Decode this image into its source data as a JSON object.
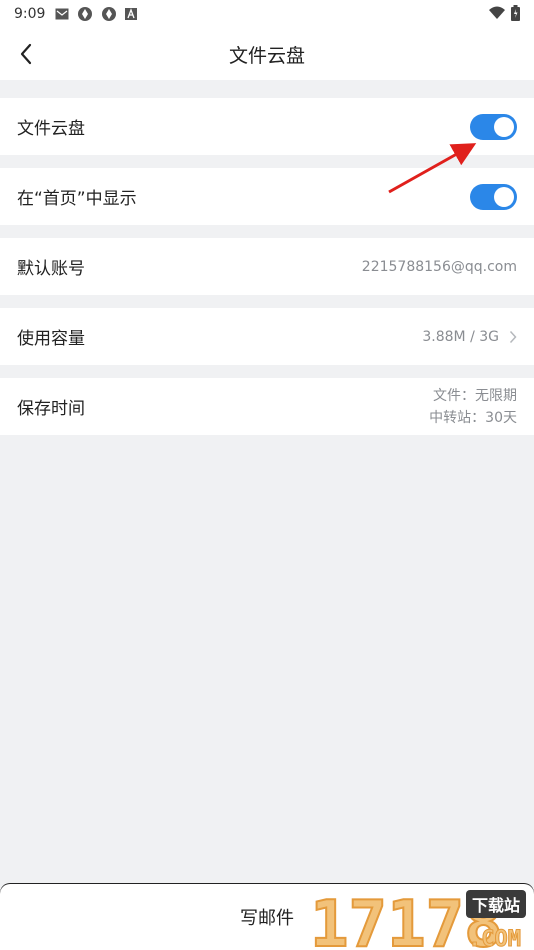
{
  "status_bar": {
    "time": "9:09",
    "icons": [
      "mail-icon",
      "app-icon",
      "app-icon",
      "a-icon"
    ],
    "right_icons": [
      "wifi-icon",
      "battery-icon"
    ]
  },
  "header": {
    "title": "文件云盘",
    "back_icon": "chevron-left-icon"
  },
  "settings": {
    "cloud_disk": {
      "label": "文件云盘",
      "enabled": true
    },
    "show_on_home": {
      "label": "在“首页”中显示",
      "enabled": true
    },
    "default_account": {
      "label": "默认账号",
      "value": "2215788156@qq.com"
    },
    "usage": {
      "label": "使用容量",
      "value": "3.88M / 3G"
    },
    "retention": {
      "label": "保存时间",
      "line1": "文件：无限期",
      "line2": "中转站：30天"
    }
  },
  "bottom": {
    "compose_label": "写邮件"
  },
  "watermark": {
    "number": "17178",
    "badge": "下载站",
    "domain": ".COM"
  },
  "colors": {
    "accent": "#2b87e8",
    "annotation": "#e0201c",
    "background": "#f0f1f3"
  }
}
